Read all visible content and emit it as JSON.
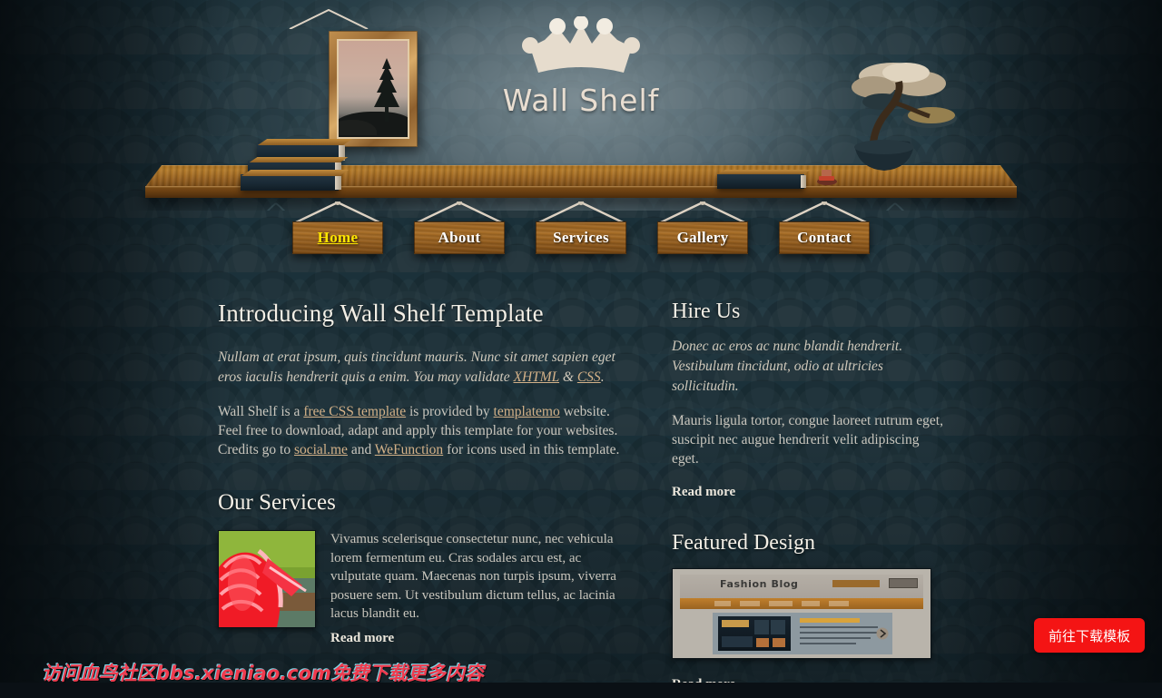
{
  "site": {
    "logo_text": "Wall Shelf",
    "logo_icon": "crown-icon"
  },
  "nav": {
    "items": [
      {
        "label": "Home",
        "active": true
      },
      {
        "label": "About",
        "active": false
      },
      {
        "label": "Services",
        "active": false
      },
      {
        "label": "Gallery",
        "active": false
      },
      {
        "label": "Contact",
        "active": false
      }
    ],
    "active_color": "#ffe600",
    "label_color": "#ffffff"
  },
  "intro": {
    "heading": "Introducing Wall Shelf Template",
    "lead_part1": "Nullam at erat ipsum, quis tincidunt mauris. Nunc sit amet sapien eget eros iaculis hendrerit quis a enim. You may validate ",
    "lead_link1": "XHTML",
    "lead_amp": " & ",
    "lead_link2": "CSS",
    "lead_end": ".",
    "body_part1": "Wall Shelf is a ",
    "body_link1": "free CSS template",
    "body_part2": " is provided by ",
    "body_link2": "templatemo",
    "body_part3": " website. Feel free to download, adapt and apply this template for your websites. Credits go to ",
    "body_link3": "social.me",
    "body_part4": " and ",
    "body_link4": "WeFunction",
    "body_part5": " for icons used in this template."
  },
  "services": {
    "heading": "Our Services",
    "thumb_alt": "red-flower-photo",
    "text": "Vivamus scelerisque consectetur nunc, nec vehicula lorem fermentum eu. Cras sodales arcu est, ac vulputate quam. Maecenas non turpis ipsum, viverra posuere sem. Ut vestibulum dictum tellus, ac lacinia lacus blandit eu.",
    "read_more": "Read more"
  },
  "hire": {
    "heading": "Hire Us",
    "lead": "Donec ac eros ac nunc blandit hendrerit. Vestibulum tincidunt, odio at ultricies sollicitudin.",
    "body": "Mauris ligula tortor, congue laoreet rutrum eget, suscipit nec augue hendrerit velit adipiscing eget.",
    "read_more": "Read more"
  },
  "featured": {
    "heading": "Featured Design",
    "preview_title": "Fashion Blog",
    "read_more": "Read more"
  },
  "overlay": {
    "watermark": "访问血鸟社区bbs.xieniao.com免费下载更多内容",
    "download_button": "前往下载模板",
    "button_color": "#f41414",
    "watermark_color": "#ef3b4e"
  },
  "theme": {
    "wall_color": "#1b313a",
    "shelf_wood": "#a9701f",
    "link_color": "#d3b188",
    "heading_color": "#f3efe6",
    "body_text_color": "#c9c6bd"
  }
}
